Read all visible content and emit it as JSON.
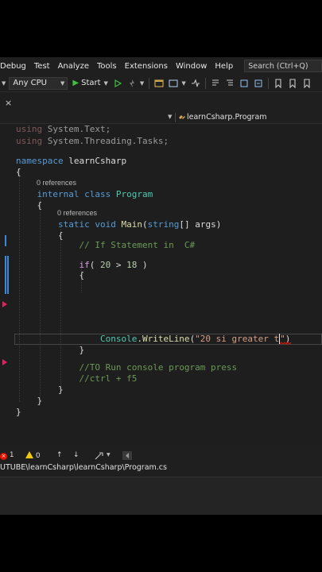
{
  "menu": {
    "items": [
      "Debug",
      "Test",
      "Analyze",
      "Tools",
      "Extensions",
      "Window",
      "Help"
    ],
    "search_placeholder": "Search (Ctrl+Q)"
  },
  "toolbar": {
    "platform": "Any CPU",
    "start_label": "Start"
  },
  "navbar": {
    "member": "learnCsharp.Program"
  },
  "code": {
    "line_using_text": [
      "using",
      " ",
      "System",
      ".",
      "Text",
      ";"
    ],
    "line_using_threading": [
      "using",
      " ",
      "System",
      ".",
      "Threading",
      ".",
      "Tasks",
      ";"
    ],
    "namespace_kw": "namespace",
    "namespace_name": "learnCsharp",
    "brace_open": "{",
    "brace_close": "}",
    "refs_class": "0 references",
    "internal_kw": "internal",
    "class_kw": "class",
    "class_name": "Program",
    "refs_main": "0 references",
    "static_kw": "static",
    "void_kw": "void",
    "main_name": "Main",
    "paren_open": "(",
    "string_kw": "string",
    "params": "[] args)",
    "comment_if": "// If Statement in  C#",
    "if_kw": "if",
    "if_open": "( ",
    "num_20": "20",
    "gt": " > ",
    "num_18": "18",
    "if_close": " )",
    "console_type": "Console",
    "dot": ".",
    "writeline": "WriteLine",
    "wl_open": "(",
    "str_value": "\"20 si greater t",
    "str_cursor_quote": "\"",
    "wl_close": ")",
    "comment_run": "//TO Run console program press",
    "comment_ctrl": "//ctrl + f5"
  },
  "status": {
    "errors": "1",
    "warnings": "0",
    "error_glyph": "×",
    "arrow_up": "↑",
    "arrow_down": "↓"
  },
  "path": {
    "text": "UTUBE\\learnCsharp\\learnCsharp\\Program.cs"
  },
  "colors": {
    "keyword": "#569cd6",
    "type": "#4ec9b0",
    "method": "#dcdcaa",
    "string": "#d69d85",
    "number": "#b5cea8",
    "comment": "#6a9955",
    "error": "#e51400",
    "warning": "#f2c811",
    "run": "#3fbf3f"
  },
  "icons": {
    "close": "×",
    "caret": "▼",
    "play": "▶"
  }
}
